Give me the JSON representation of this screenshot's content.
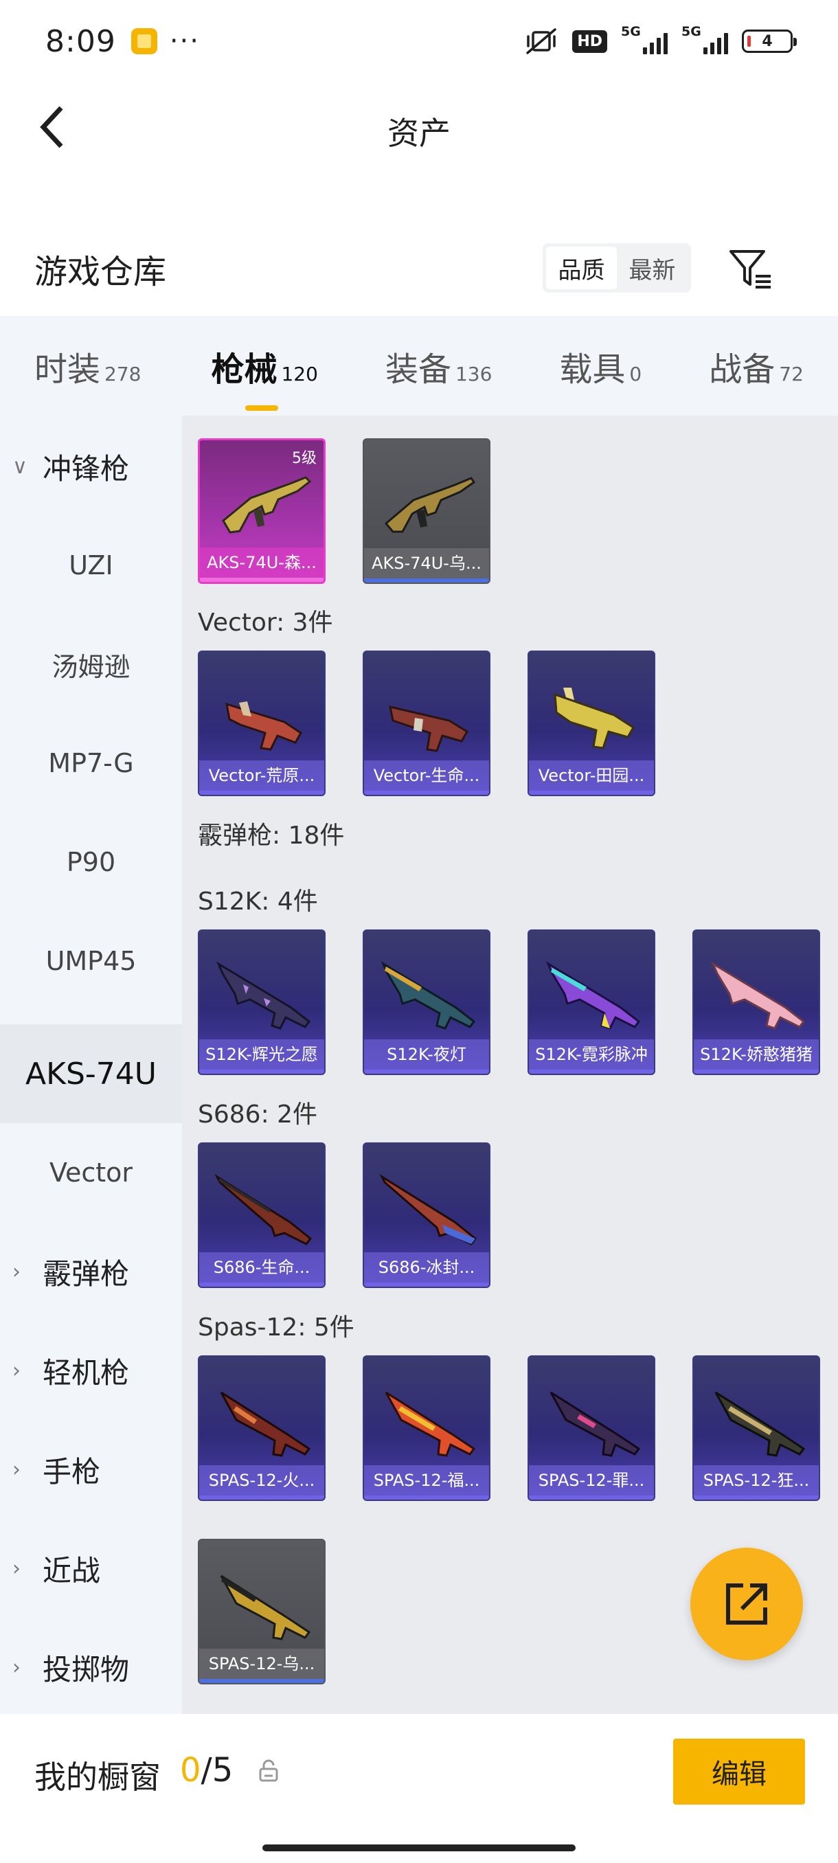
{
  "status_bar": {
    "time": "8:09",
    "more": "···",
    "hd_badge": "HD",
    "signal1_label": "5G",
    "signal2_label": "5G",
    "battery": "4"
  },
  "header": {
    "title": "资产"
  },
  "warehouse": {
    "title": "游戏仓库",
    "sort_quality": "品质",
    "sort_newest": "最新"
  },
  "tabs": [
    {
      "label": "时装",
      "count": "278"
    },
    {
      "label": "枪械",
      "count": "120"
    },
    {
      "label": "装备",
      "count": "136"
    },
    {
      "label": "载具",
      "count": "0"
    },
    {
      "label": "战备",
      "count": "72"
    }
  ],
  "sidebar": {
    "items": [
      {
        "label": "冲锋枪"
      },
      {
        "label": "UZI"
      },
      {
        "label": "汤姆逊"
      },
      {
        "label": "MP7-G"
      },
      {
        "label": "P90"
      },
      {
        "label": "UMP45"
      },
      {
        "label": "AKS-74U"
      },
      {
        "label": "Vector"
      },
      {
        "label": "霰弹枪"
      },
      {
        "label": "轻机枪"
      },
      {
        "label": "手枪"
      },
      {
        "label": "近战"
      },
      {
        "label": "投掷物"
      }
    ]
  },
  "content": {
    "sections": {
      "vector": "Vector: 3件",
      "shotgun": "霰弹枪: 18件",
      "s12k": "S12K: 4件",
      "s686": "S686: 2件",
      "spas": "Spas-12: 5件"
    },
    "cards": {
      "aks_1": {
        "name": "AKS-74U-森...",
        "level": "5级"
      },
      "aks_2": {
        "name": "AKS-74U-乌..."
      },
      "vector_1": {
        "name": "Vector-荒原..."
      },
      "vector_2": {
        "name": "Vector-生命..."
      },
      "vector_3": {
        "name": "Vector-田园..."
      },
      "s12k_1": {
        "name": "S12K-辉光之愿"
      },
      "s12k_2": {
        "name": "S12K-夜灯"
      },
      "s12k_3": {
        "name": "S12K-霓彩脉冲"
      },
      "s12k_4": {
        "name": "S12K-娇憨猪猪"
      },
      "s686_1": {
        "name": "S686-生命..."
      },
      "s686_2": {
        "name": "S686-冰封..."
      },
      "spas_1": {
        "name": "SPAS-12-火..."
      },
      "spas_2": {
        "name": "SPAS-12-福..."
      },
      "spas_3": {
        "name": "SPAS-12-罪..."
      },
      "spas_4": {
        "name": "SPAS-12-狂..."
      },
      "spas_5": {
        "name": "SPAS-12-乌..."
      }
    }
  },
  "bottom_bar": {
    "title": "我的橱窗",
    "count_current": "0",
    "count_total": "/5",
    "edit_label": "编辑"
  },
  "colors": {
    "accent": "#f7b500",
    "card_purple": "#302b78",
    "card_pink": "#c43dc4",
    "card_grey": "#4a4b50"
  }
}
